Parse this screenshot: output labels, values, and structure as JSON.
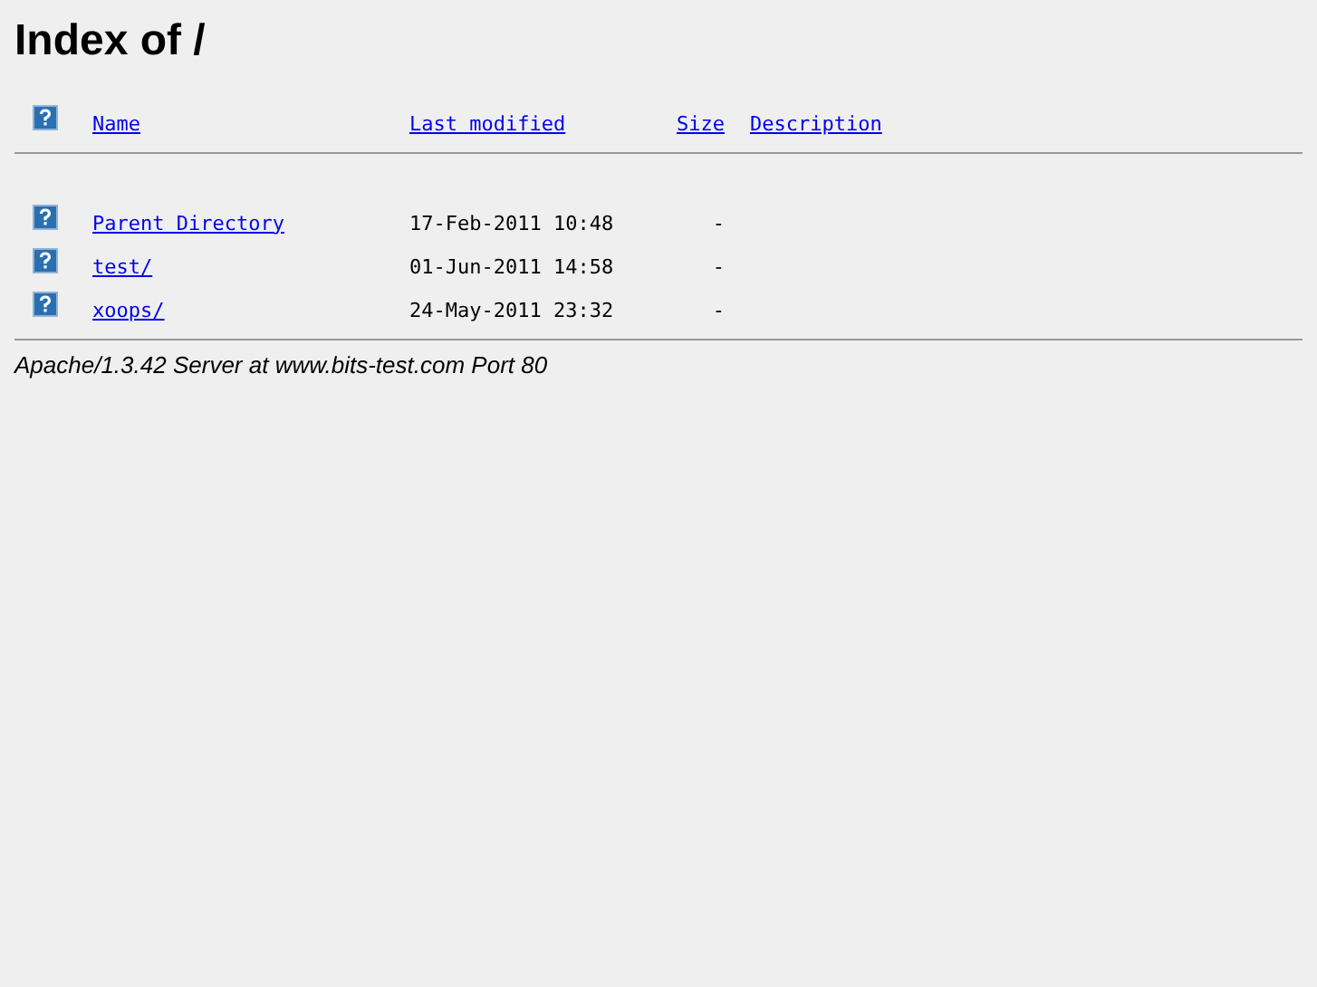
{
  "title": "Index of /",
  "columns": [
    "Name",
    "Last modified",
    "Size",
    "Description"
  ],
  "rows": [
    {
      "name": "Parent Directory",
      "modified": "17-Feb-2011 10:48",
      "size": "-"
    },
    {
      "name": "test/",
      "modified": "01-Jun-2011 14:58",
      "size": "-"
    },
    {
      "name": "xoops/",
      "modified": "24-May-2011 23:32",
      "size": "-"
    }
  ],
  "footer": "Apache/1.3.42 Server at www.bits-test.com Port 80"
}
